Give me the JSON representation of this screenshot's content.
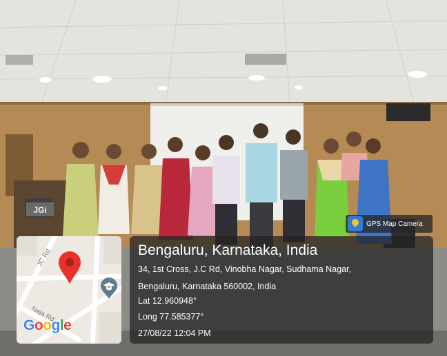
{
  "watermark": {
    "label": "GPS Map Camera",
    "icon": "gps-map-camera-logo-icon"
  },
  "map": {
    "brand": "Google",
    "brand_colors": [
      "#4285F4",
      "#EA4335",
      "#FBBC05",
      "#4285F4",
      "#34A853",
      "#EA4335"
    ],
    "street_labels": [
      "JC Rd",
      "Nala Rd"
    ],
    "pin_icon": "location-pin-icon",
    "poi_icon": "graduation-cap-icon"
  },
  "location": {
    "title": "Bengaluru, Karnataka, India",
    "address_line1": "34, 1st Cross, J.C Rd, Vinobha Nagar, Sudhama Nagar,",
    "address_line2": "Bengaluru, Karnataka 560002, India",
    "latitude": "Lat 12.960948°",
    "longitude": "Long 77.585377°",
    "datetime": "27/08/22 12:04 PM"
  },
  "scene": {
    "podium_logo": "JGi",
    "colors": {
      "ceiling": "#e4e4e0",
      "wall": "#b58a55",
      "screen": "#eeeeea",
      "floor": "#8a8a86"
    }
  }
}
